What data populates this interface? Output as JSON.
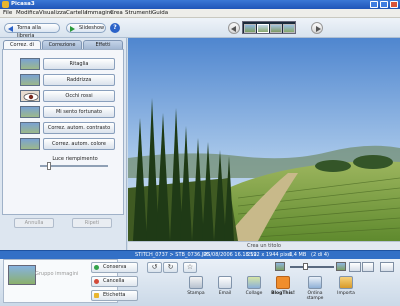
{
  "window": {
    "title": "Picasa3"
  },
  "menu": [
    "File",
    "Modifica",
    "Visualizza",
    "Cartella",
    "Immagine",
    "Crea",
    "Strumenti",
    "Guida"
  ],
  "toolbar": {
    "back_label": "Torna alla libreria",
    "slideshow_label": "Slideshow",
    "help_label": "?"
  },
  "edit_panel": {
    "tabs": [
      "Correz. di base",
      "Correzione",
      "Effetti"
    ],
    "tools": [
      "Ritaglia",
      "Raddrizza",
      "Occhi rossi",
      "Mi sento fortunato",
      "Correz. autom. contrasto",
      "Correz. autom. colore"
    ],
    "slider_label": "Luce riempimento",
    "undo_label": "Annulla",
    "redo_label": "Ripeti"
  },
  "photo": {
    "caption_placeholder": "Crea un titolo"
  },
  "status": {
    "filename": "STITCH_0737 > STB_0736.JPG",
    "date": "25/08/2006 16.18.12",
    "dimensions": "2592 x 1944 pixel",
    "size": "1,4 MB",
    "index": "(2 di 4)"
  },
  "tray": {
    "label": "Gruppo immagini",
    "keep_label": "Conserva",
    "clear_label": "Cancella",
    "tag_label": "Etichetta",
    "actions": [
      "Stampa",
      "Email",
      "Collage",
      "BlogThis!",
      "Ordina stampe",
      "Importa"
    ]
  },
  "colors": {
    "titlebar": "#1f55b8",
    "statusbar": "#3370c6",
    "accent": "#2b62c8"
  }
}
